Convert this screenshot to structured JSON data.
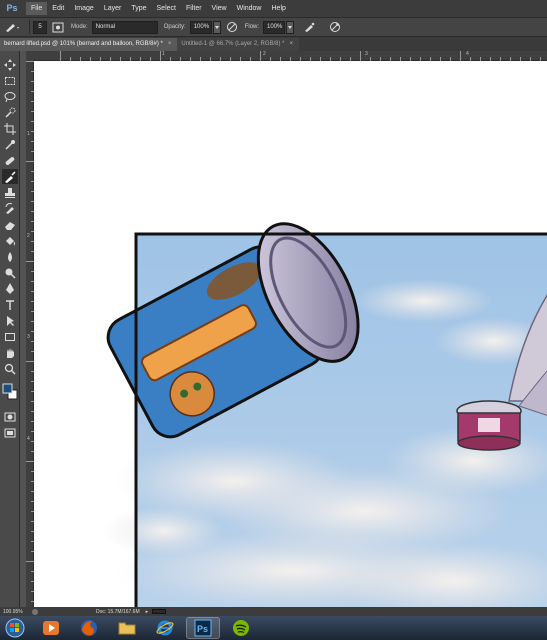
{
  "app": {
    "logo": "Ps",
    "menu": [
      "File",
      "Edit",
      "Image",
      "Layer",
      "Type",
      "Select",
      "Filter",
      "View",
      "Window",
      "Help"
    ]
  },
  "options": {
    "brush_size": "5",
    "mode_label": "Mode:",
    "mode_value": "Normal",
    "opacity_label": "Opacity:",
    "opacity_value": "100%",
    "flow_label": "Flow:",
    "flow_value": "100%"
  },
  "tabs": [
    {
      "label": "bernard lifted.psd @ 101% (bernard and balloon, RGB/8#) *",
      "close": "×"
    },
    {
      "label": "Untitled-1 @ 66.7% (Layer 2, RGB/8) *",
      "close": "×"
    }
  ],
  "rulers": {
    "top": [
      "1",
      "2",
      "3",
      "4"
    ],
    "left": [
      "1",
      "2",
      "3",
      "4"
    ]
  },
  "status": {
    "zoom": "100.95%",
    "doc": "Doc: 15.7M/167.6M"
  },
  "taskbar": {
    "items": [
      "start-orb",
      "media-player",
      "firefox",
      "file-explorer",
      "internet-explorer",
      "photoshop",
      "spotify"
    ]
  },
  "colors": {
    "sky": "#a9c9e6",
    "can_label": "#3a7fc4",
    "lid": "#8d86a8",
    "frame": "#111111",
    "wing": "#cfc9d8",
    "foreground": "#1b4f7a"
  }
}
